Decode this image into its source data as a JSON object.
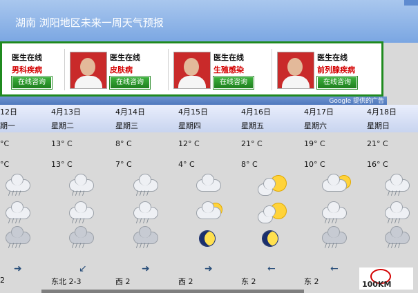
{
  "header": {
    "title": "湖南 浏阳地区未来一周天气预报"
  },
  "ad": {
    "source_label": "Google 提供的广告",
    "units": [
      {
        "title": "医生在线",
        "subtitle": "男科疾病",
        "button": "在线咨询"
      },
      {
        "title": "医生在线",
        "subtitle": "皮肤病",
        "button": "在线咨询"
      },
      {
        "title": "医生在线",
        "subtitle": "生殖感染",
        "button": "在线咨询"
      },
      {
        "title": "医生在线",
        "subtitle": "前列腺疾病",
        "button": "在线咨询"
      }
    ]
  },
  "forecast": [
    {
      "date": "12日",
      "weekday": "期一",
      "high": "°C",
      "low": "°C",
      "wind_dir": "",
      "wind": "2"
    },
    {
      "date": "4月13日",
      "weekday": "星期二",
      "high": "13° C",
      "low": "13° C",
      "wind_dir": "东北",
      "wind": "2-3"
    },
    {
      "date": "4月14日",
      "weekday": "星期三",
      "high": "8° C",
      "low": "7° C",
      "wind_dir": "西",
      "wind": "2"
    },
    {
      "date": "4月15日",
      "weekday": "星期四",
      "high": "12° C",
      "low": "4° C",
      "wind_dir": "西",
      "wind": "2"
    },
    {
      "date": "4月16日",
      "weekday": "星期五",
      "high": "21° C",
      "low": "8° C",
      "wind_dir": "东",
      "wind": "2"
    },
    {
      "date": "4月17日",
      "weekday": "星期六",
      "high": "19° C",
      "low": "10° C",
      "wind_dir": "东",
      "wind": "2"
    },
    {
      "date": "4月18日",
      "weekday": "星期日",
      "high": "21° C",
      "low": "16° C",
      "wind_dir": "",
      "wind": ""
    }
  ],
  "logo": {
    "text": "100KM"
  }
}
